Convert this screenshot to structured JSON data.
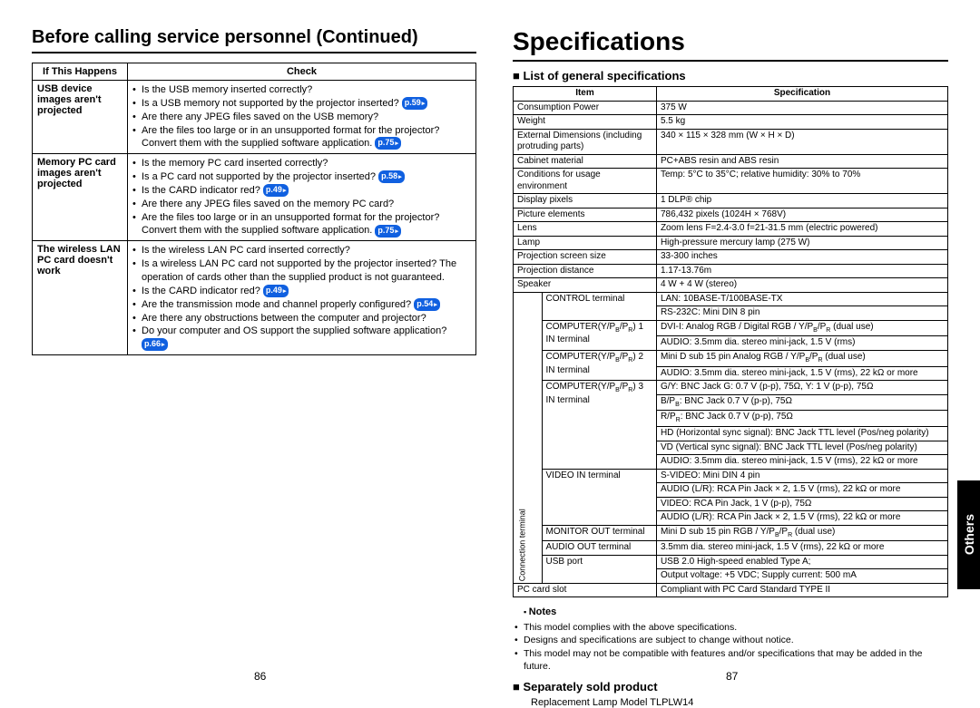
{
  "left": {
    "title": "Before calling service personnel (Continued)",
    "head_if": "If  This Happens",
    "head_check": "Check",
    "rows": [
      {
        "if": "USB device images aren't projected",
        "checks": [
          "Is the USB memory inserted correctly?",
          "Is a USB memory not supported by the projector inserted? |p.59|",
          "Are there any JPEG files saved on the USB memory?",
          "Are the files too large or in an unsupported format for the projector? Convert them with the supplied software application. |p.75|"
        ]
      },
      {
        "if": "Memory PC card images aren't projected",
        "checks": [
          "Is the memory PC card inserted correctly?",
          "Is a PC card not supported by the projector inserted? |p.58|",
          "Is the CARD indicator red? |p.49|",
          "Are there any JPEG files saved on the memory PC card?",
          "Are the files too large or in an unsupported format for the projector? Convert them with the supplied software application. |p.75|"
        ]
      },
      {
        "if": "The wireless LAN PC card doesn't work",
        "checks": [
          "Is the wireless LAN PC card inserted correctly?",
          "Is a wireless LAN PC card not supported by the projector inserted? The operation of cards other than the supplied product is not guaranteed.",
          "Is the CARD indicator red? |p.49|",
          "Are the transmission mode and channel properly configured? |p.54|",
          "Are there any obstructions between the computer and projector?",
          "Do your computer and OS support the supplied software application? |p.66|"
        ]
      }
    ],
    "pagenum": "86"
  },
  "right": {
    "title": "Specifications",
    "sub_general": "List of general specifications",
    "head_item": "Item",
    "head_spec": "Specification",
    "rows_top": [
      {
        "item": "Consumption Power",
        "spec": "375 W"
      },
      {
        "item": "Weight",
        "spec": "5.5 kg"
      },
      {
        "item": "External Dimensions (including protruding parts)",
        "spec": "340 × 115 × 328 mm (W × H × D)"
      },
      {
        "item": "Cabinet material",
        "spec": "PC+ABS resin and ABS resin"
      },
      {
        "item": "Conditions for usage environment",
        "spec": "Temp: 5°C to 35°C; relative humidity: 30% to 70%"
      },
      {
        "item": "Display pixels",
        "spec": "1 DLP® chip"
      },
      {
        "item": "Picture elements",
        "spec": "786,432 pixels (1024H × 768V)"
      },
      {
        "item": "Lens",
        "spec": "Zoom lens   F=2.4-3.0  f=21-31.5 mm (electric powered)"
      },
      {
        "item": "Lamp",
        "spec": "High-pressure mercury lamp (275 W)"
      },
      {
        "item": "Projection screen size",
        "spec": "33-300 inches"
      },
      {
        "item": "Projection distance",
        "spec": "1.17-13.76m"
      },
      {
        "item": "Speaker",
        "spec": "4 W + 4 W (stereo)"
      }
    ],
    "conn_label": "Connection terminal",
    "conn_rows": [
      {
        "sub": "CONTROL terminal",
        "spec": [
          "LAN: 10BASE-T/100BASE-TX",
          "RS-232C: Mini DIN 8 pin"
        ]
      },
      {
        "sub": "COMPUTER(Y/PB/PR) 1 IN terminal",
        "spec": [
          "DVI-I: Analog RGB / Digital RGB / Y/PB/PR (dual use)",
          "AUDIO: 3.5mm dia. stereo mini-jack, 1.5 V (rms)"
        ]
      },
      {
        "sub": "COMPUTER(Y/PB/PR) 2 IN terminal",
        "spec": [
          "Mini D sub 15 pin  Analog RGB / Y/PB/PR (dual use)",
          "AUDIO: 3.5mm dia. stereo mini-jack, 1.5 V (rms), 22 kΩ or more"
        ]
      },
      {
        "sub": "COMPUTER(Y/PB/PR) 3 IN terminal",
        "spec": [
          "G/Y: BNC Jack  G: 0.7 V (p-p), 75Ω, Y: 1 V (p-p), 75Ω",
          "B/PB: BNC Jack  0.7 V (p-p), 75Ω",
          "R/PR: BNC Jack  0.7 V (p-p), 75Ω",
          "HD (Horizontal sync signal): BNC Jack  TTL level (Pos/neg polarity)",
          "VD (Vertical sync signal): BNC Jack  TTL level (Pos/neg polarity)",
          "AUDIO: 3.5mm dia. stereo mini-jack, 1.5 V (rms), 22 kΩ or more"
        ]
      },
      {
        "sub": "VIDEO IN terminal",
        "spec": [
          "S-VIDEO: Mini DIN 4 pin",
          "AUDIO (L/R): RCA Pin Jack × 2, 1.5 V (rms), 22 kΩ or more",
          "VIDEO: RCA Pin Jack, 1 V (p-p), 75Ω",
          "AUDIO (L/R): RCA Pin Jack × 2, 1.5 V (rms), 22 kΩ or more"
        ]
      },
      {
        "sub": "MONITOR OUT terminal",
        "spec": [
          "Mini D sub 15 pin  RGB / Y/PB/PR (dual use)"
        ]
      },
      {
        "sub": "AUDIO OUT terminal",
        "spec": [
          "3.5mm dia. stereo mini-jack, 1.5 V (rms), 22 kΩ or more"
        ]
      },
      {
        "sub": "USB port",
        "spec": [
          "USB 2.0 High-speed enabled Type A;",
          "Output voltage: +5 VDC; Supply current: 500 mA"
        ]
      }
    ],
    "pc_card": {
      "item": "PC card slot",
      "spec": "Compliant with PC Card Standard TYPE II"
    },
    "notes_head": "Notes",
    "notes": [
      "This model complies with the above specifications.",
      "Designs and specifications are subject to change without notice.",
      "This model may not be compatible with features and/or specifications that may be added in the future."
    ],
    "sub_separate": "Separately sold product",
    "separate_text": "Replacement Lamp        Model TLPLW14",
    "side_tab": "Others",
    "pagenum": "87"
  }
}
